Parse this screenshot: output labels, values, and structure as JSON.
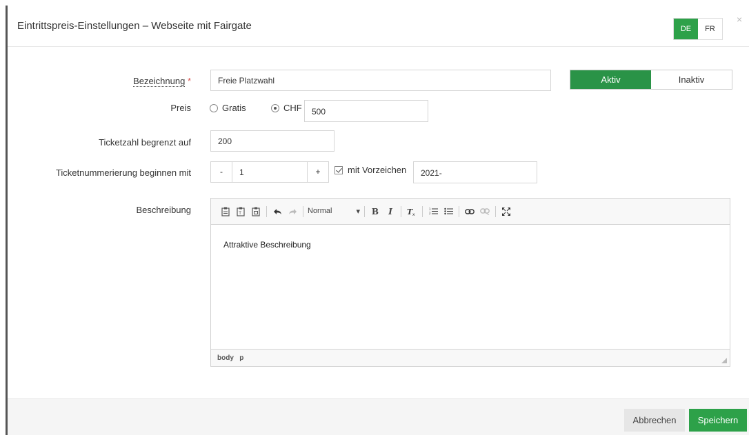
{
  "header": {
    "title": "Eintrittspreis-Einstellungen – Webseite mit Fairgate",
    "languages": [
      {
        "code": "DE",
        "active": true
      },
      {
        "code": "FR",
        "active": false
      }
    ],
    "close_glyph": "×"
  },
  "form": {
    "name": {
      "label": "Bezeichnung",
      "required_marker": "*",
      "value": "Freie Platzwahl"
    },
    "status": {
      "active_label": "Aktiv",
      "inactive_label": "Inaktiv",
      "selected": "Aktiv"
    },
    "price": {
      "label": "Preis",
      "option_free": "Gratis",
      "option_chf": "CHF",
      "selected": "CHF",
      "value": "500"
    },
    "ticket_limit": {
      "label": "Ticketzahl begrenzt auf",
      "value": "200"
    },
    "numbering": {
      "label": "Ticketnummerierung beginnen mit",
      "minus": "-",
      "value": "1",
      "plus": "+",
      "prefix_checkbox_label": "mit Vorzeichen",
      "prefix_checked": true,
      "prefix_value": "2021-"
    },
    "description": {
      "label": "Beschreibung",
      "format_value": "Normal",
      "content": "Attraktive Beschreibung",
      "status_path": [
        "body",
        "p"
      ]
    }
  },
  "footer": {
    "cancel_label": "Abbrechen",
    "save_label": "Speichern"
  },
  "colors": {
    "accent": "#2da149",
    "required": "#d9534f"
  }
}
